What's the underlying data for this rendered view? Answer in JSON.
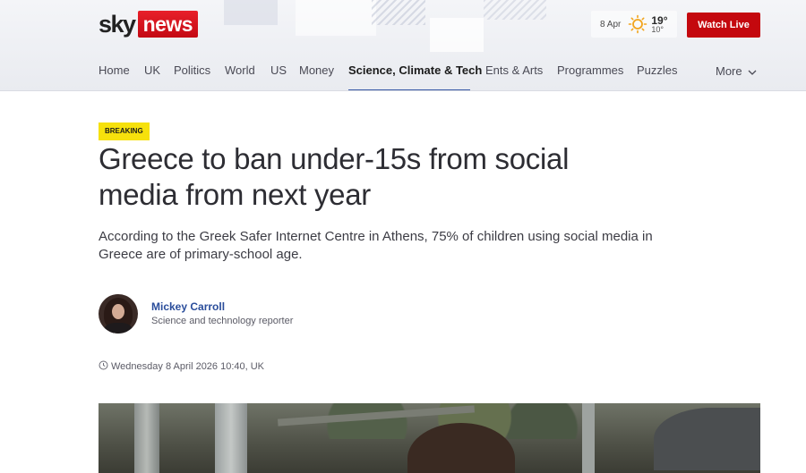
{
  "brand": {
    "sky": "sky",
    "news": "news",
    "accent": "#c4080e"
  },
  "weather": {
    "date": "8 Apr",
    "high": "19°",
    "low": "10°",
    "icon": "sun-icon"
  },
  "header": {
    "watch_live": "Watch Live"
  },
  "nav": {
    "items": [
      {
        "label": "Home"
      },
      {
        "label": "UK"
      },
      {
        "label": "Politics"
      },
      {
        "label": "World"
      },
      {
        "label": "US"
      },
      {
        "label": "Money"
      },
      {
        "label": "Science, Climate & Tech",
        "active": true
      },
      {
        "label": "Ents & Arts"
      },
      {
        "label": "Programmes"
      },
      {
        "label": "Puzzles"
      }
    ],
    "more": "More"
  },
  "article": {
    "badge": "Breaking",
    "headline": "Greece to ban under-15s from social media from next year",
    "standfirst": "According to the Greek Safer Internet Centre in Athens, 75% of children using social media in Greece are of primary-school age.",
    "author": {
      "name": "Mickey Carroll",
      "role": "Science and technology reporter"
    },
    "timestamp": "Wednesday 8 April 2026 10:40, UK"
  }
}
